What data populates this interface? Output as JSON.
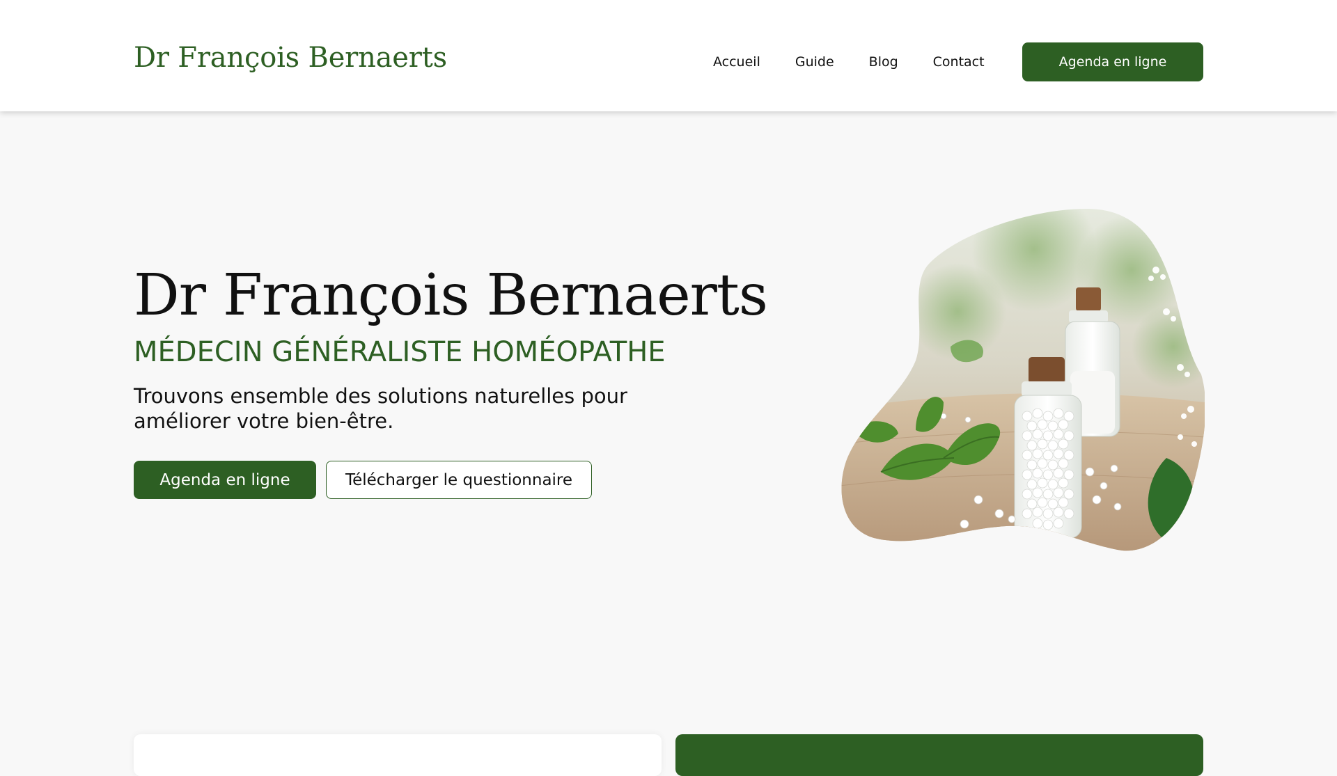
{
  "header": {
    "brand": "Dr François Bernaerts",
    "nav": [
      {
        "label": "Accueil"
      },
      {
        "label": "Guide"
      },
      {
        "label": "Blog"
      },
      {
        "label": "Contact"
      }
    ],
    "cta_label": "Agenda en ligne"
  },
  "hero": {
    "title": "Dr François Bernaerts",
    "subtitle": "MÉDECIN GÉNÉRALISTE HOMÉOPATHE",
    "tagline": "Trouvons ensemble des solutions naturelles pour améliorer votre bien-être.",
    "primary_button": "Agenda en ligne",
    "secondary_button": "Télécharger le questionnaire"
  },
  "theme": {
    "accent": "#2d5f23",
    "background": "#f8f8f8"
  },
  "icons": {
    "hero_image": "homeopathy-bottles-image"
  }
}
